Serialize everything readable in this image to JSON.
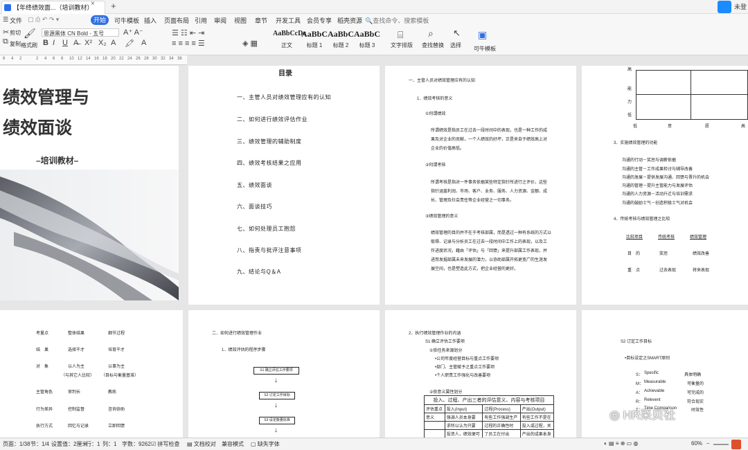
{
  "titlebar": {
    "doc_tab": "【年终绩效面...（培训教材）",
    "close": "×",
    "add": "+",
    "user": "未登"
  },
  "menubar": {
    "items": [
      "文件",
      "开始",
      "模板",
      "插入",
      "页面布局",
      "引用",
      "审阅",
      "视图",
      "章节",
      "开发工具",
      "会员专享",
      "稻壳资源"
    ],
    "start": "开始",
    "template": "可牛模板",
    "search": "查找命令、搜索模板"
  },
  "ribbon": {
    "cut": "剪切",
    "paste": "粘贴",
    "copy": "复制",
    "format_painter": "格式刷",
    "font": "思源黑体 CN Bold - 五号",
    "styles": [
      {
        "preview": "AaBbCcDc",
        "name": "正文"
      },
      {
        "preview": "AaBbC",
        "name": "标题 1"
      },
      {
        "preview": "AaBbC",
        "name": "标题 2"
      },
      {
        "preview": "AaBbC",
        "name": "标题 3"
      }
    ],
    "text_layout": "文字排版",
    "find_replace": "查找替换",
    "select": "选择",
    "template": "可牛模板"
  },
  "ruler": {
    "ticks": [
      "6",
      "4",
      "2",
      "",
      "2",
      "4",
      "6",
      "8",
      "10",
      "12",
      "14",
      "16",
      "18",
      "20",
      "22",
      "24",
      "26",
      "28",
      "30",
      "32",
      "34",
      "36"
    ]
  },
  "page1": {
    "title1": "绩效管理与",
    "title2": "绩效面谈",
    "subtitle": "–培训教材–"
  },
  "page2": {
    "heading": "目录",
    "items": [
      "一、主管人员对绩效管理应有的认知",
      "二、如何进行绩效评估作业",
      "三、绩效管理的辅助制度",
      "四、绩效考核结果之应用",
      "五、绩效面谈",
      "六、面谈技巧",
      "七、如何处理员工抱怨",
      "八、指责与批评注意事项",
      "九、结论与Q＆A"
    ]
  },
  "page3": {
    "h1": "一．主管人员对绩效管理应有的认知",
    "h2": "1．绩效考核的意义",
    "s1": "①何谓绩效",
    "p1": [
      "所谓绩效是指员工在过去一段时间中的表现，也是一种工作的成",
      "果及对企业的贡献，一个人绩效的好坏，正是来自于绩效高上对",
      "企业的价值高低。"
    ],
    "s2": "②何谓考核",
    "p2": [
      "所谓考核是指对一件事务依据某些特定指针所进行之评价，这些",
      "指针涵盖利润、市场、客户、业务、服务、人力资源、金额、成",
      "长、管理及社会责任等企业经营之一切事务。"
    ],
    "s3": "③绩效管理的意义",
    "p3": [
      "绩效管理的目的并不在于考核部属，而是透过一种有系统的方式以",
      "取得、记录与分析员工在过去一段时间中工作上的表现，以及工",
      "作进度状况，藉由「评估」与「回馈」来提升部属工作表现，并",
      "进而发掘部属未来发展的潜力，以协助部属开拓更宽广的生涯发",
      "展空间，也是塑造此方式，把企业经营的更好。"
    ]
  },
  "page4": {
    "ylabels": [
      "能",
      "力",
      "低"
    ],
    "ytop": "高",
    "xlabels": [
      "低",
      "意",
      "愿",
      "高"
    ],
    "h3": "3．实施绩效管理的功能",
    "func": [
      "沟通的行动－奖惩与调薪依据",
      "沟通的主管－工作成果检讨与辅导改善",
      "沟通的发展－提供发展沟通、回馈与晋升的机会",
      "沟通的管理－提升主管能力与发展评估",
      "沟通的人力资源－活动升迁与培训需求",
      "沟通的鼓励士气－创造积极士气对机会"
    ],
    "h4": "4．传统考核与绩效管理之比较",
    "thead": [
      "比较项目",
      "传统考核",
      "绩效管理"
    ],
    "rows": [
      [
        "目　的",
        "奖惩",
        "绩效改善"
      ],
      [
        "重　点",
        "过去表现",
        "将来表现"
      ]
    ]
  },
  "page5": {
    "rows": [
      [
        "考量点",
        "整体结果",
        "细节过程"
      ],
      [
        "结　果",
        "选择干才",
        "培育干才"
      ],
      [
        "对　象",
        "以人为主",
        "以事为主"
      ],
      [
        "",
        "（与其它人比较）",
        "（目标与衡量基准）"
      ],
      [
        "主管角色",
        "审判长",
        "教练"
      ],
      [
        "行为差异",
        "控制监督",
        "咨询协助"
      ],
      [
        "执行方式",
        "回忆与记录",
        "立即回馈"
      ]
    ]
  },
  "page6": {
    "h": "二．如何进行绩效管理作业",
    "sub": "1．绩效评估的程序步骤",
    "steps": [
      "S1 确立评估工作要项",
      "S2 订定工作目标",
      "S3 设定衡量标准"
    ]
  },
  "page7": {
    "h": "2．执行绩效管理作业的内涵",
    "sub": "S1 确立评估工作要项",
    "a": "①依任务来源划分",
    "bullets": [
      "•公司年度经营目标与重点工作要项",
      "•部门、主管赋予之重点工作要项",
      "•个人职责工作强化与改善要项"
    ],
    "b": "②依意义属性划分",
    "table_title": "投入、过程、产出三者的评估意义、内容与考核项目",
    "table_head": [
      "评估重点",
      "投入(Input)",
      "过程(Process)",
      "产出(Output)"
    ],
    "table_row": [
      "意义",
      "强调人员本身要",
      "有些工作强调生产",
      "有些工作不是在"
    ],
    "table_row2": [
      "",
      "求所以认为只要",
      "过程的正确性时",
      "投入或过程，关"
    ],
    "table_row3": [
      "",
      "投资人，绩效便可",
      "了员工在付出",
      "产出的成果本身"
    ]
  },
  "page8": {
    "h": "S2 订定工作目标",
    "sub": "•目标设定之SMART原则",
    "smart": [
      [
        "S：",
        "Specific",
        "具体明确"
      ],
      [
        "M：",
        "Measurable",
        "可衡量的"
      ],
      [
        "A：",
        "Achievable",
        "可完成的"
      ],
      [
        "R：",
        "Relevent",
        "符合现实"
      ],
      [
        "T：",
        "Time Comparison",
        "时效性"
      ]
    ]
  },
  "watermark": "HR采贝社",
  "status": {
    "page": "页面：1/38",
    "section": "节：1/4",
    "setting": "设置值：2厘米",
    "row": "行：1",
    "col": "列：1",
    "words": "字数：9262",
    "spell": "拼写检查",
    "doccheck": "文档校对",
    "compat": "兼容模式",
    "font_missing": "缺失字体",
    "zoom": "60%"
  }
}
